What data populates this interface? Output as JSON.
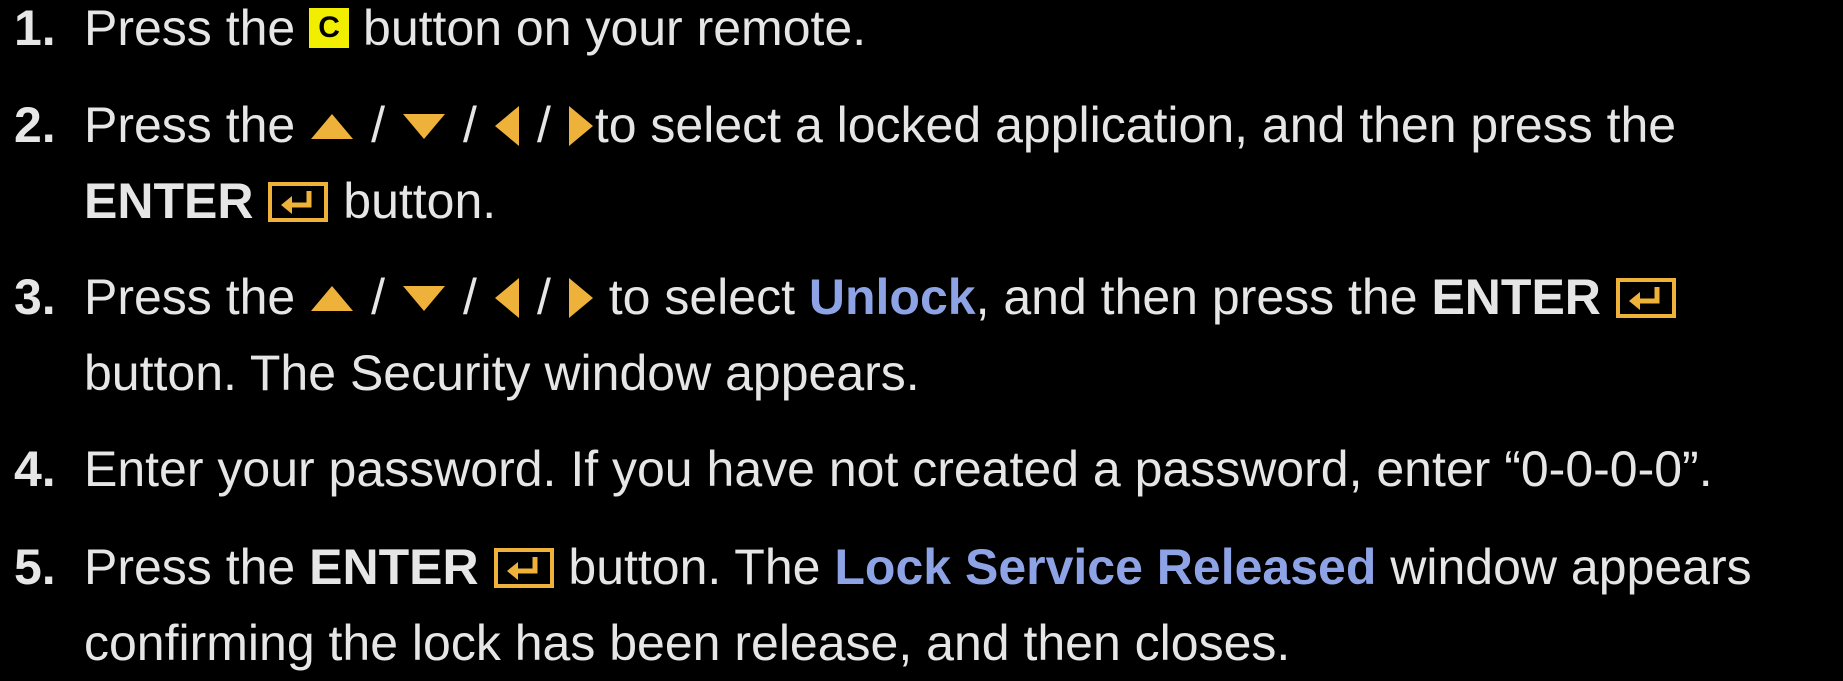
{
  "colors": {
    "background": "#000000",
    "text": "#e6e6e6",
    "highlight": "#8ea3e6",
    "arrow": "#eeb23a",
    "c_button": "#f2ee00"
  },
  "icons": {
    "c_button": "c-button-icon",
    "up": "triangle-up-icon",
    "down": "triangle-down-icon",
    "left": "triangle-left-icon",
    "right": "triangle-right-icon",
    "enter": "enter-icon"
  },
  "c_button_letter": "C",
  "slash": "/",
  "steps": [
    {
      "number": "1.",
      "press_the": "Press the",
      "rest": "button on your remote."
    },
    {
      "number": "2.",
      "press_the": "Press the",
      "to_select": "to select a locked application, and then press the",
      "enter": "ENTER",
      "rest": "button."
    },
    {
      "number": "3.",
      "press_the": "Press the",
      "to_select": "to select",
      "unlock": "Unlock",
      "and_then": ", and then press the",
      "enter": "ENTER",
      "rest": "button. The Security window appears."
    },
    {
      "number": "4.",
      "text": "Enter your password. If you have not created a password, enter “0-0-0-0”."
    },
    {
      "number": "5.",
      "press_the": "Press the",
      "enter": "ENTER",
      "button_the": "button. The",
      "highlight": "Lock Service Released",
      "after": "window appears",
      "rest": "confirming the lock has been release, and then closes."
    }
  ]
}
